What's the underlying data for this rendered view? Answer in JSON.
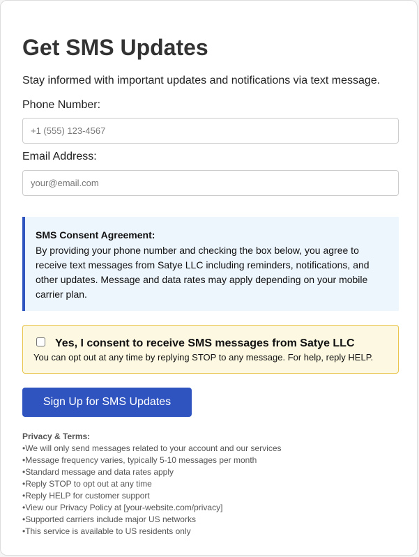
{
  "form": {
    "title": "Get SMS Updates",
    "subtitle": "Stay informed with important updates and notifications via text message.",
    "phone": {
      "label": "Phone Number:",
      "placeholder": "+1 (555) 123-4567",
      "value": ""
    },
    "email": {
      "label": "Email Address:",
      "placeholder": "your@email.com",
      "value": ""
    }
  },
  "consent_info": {
    "title": "SMS Consent Agreement:",
    "body": "By providing your phone number and checking the box below, you agree to receive text messages from Satye LLC including reminders, notifications, and other updates. Message and data rates may apply depending on your mobile carrier plan."
  },
  "consent": {
    "checked": false,
    "label": "Yes, I consent to receive SMS messages from Satye LLC",
    "note": "You can opt out at any time by replying STOP to any message. For help, reply HELP."
  },
  "submit": {
    "label": "Sign Up for SMS Updates"
  },
  "privacy": {
    "title": "Privacy & Terms:",
    "items": [
      "We will only send messages related to your account and our services",
      "Message frequency varies, typically 5-10 messages per month",
      "Standard message and data rates apply",
      "Reply STOP to opt out at any time",
      "Reply HELP for customer support",
      "View our Privacy Policy at [your-website.com/privacy]",
      "Supported carriers include major US networks",
      "This service is available to US residents only"
    ]
  },
  "colors": {
    "accent": "#2f54c0",
    "info_background": "#edf5fd",
    "consent_background": "#fdf8e1",
    "consent_border": "#e8c44a"
  }
}
